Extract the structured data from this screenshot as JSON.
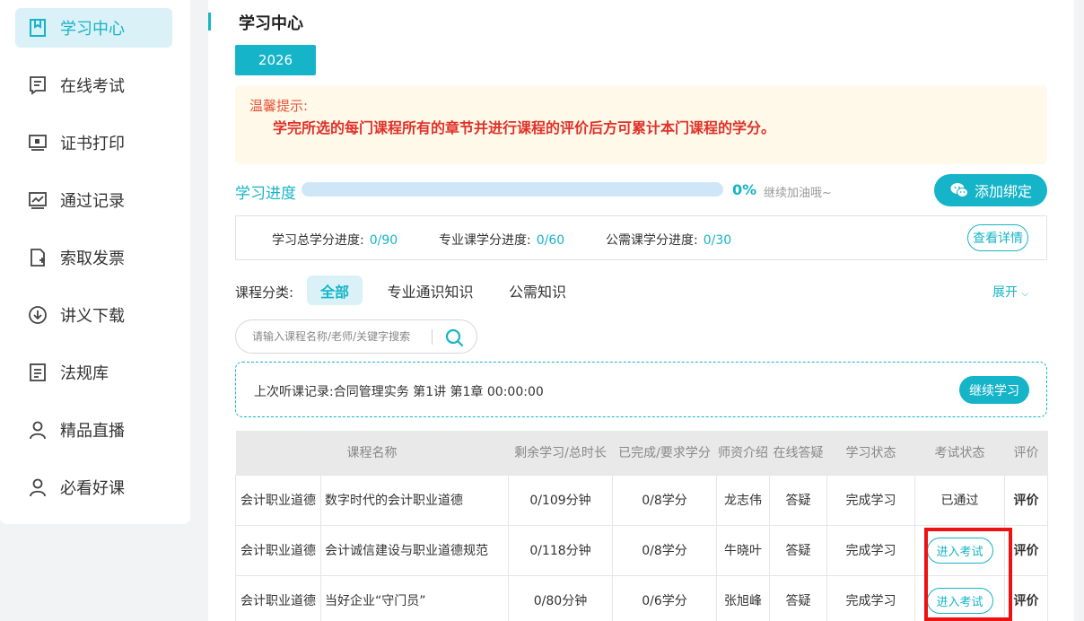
{
  "sidebar": {
    "items": [
      {
        "label": "学习中心",
        "icon": "bookmark-icon",
        "active": true
      },
      {
        "label": "在线考试",
        "icon": "exam-icon",
        "active": false
      },
      {
        "label": "证书打印",
        "icon": "certificate-icon",
        "active": false
      },
      {
        "label": "通过记录",
        "icon": "chart-icon",
        "active": false
      },
      {
        "label": "索取发票",
        "icon": "invoice-icon",
        "active": false
      },
      {
        "label": "讲义下载",
        "icon": "download-icon",
        "active": false
      },
      {
        "label": "法规库",
        "icon": "document-icon",
        "active": false
      },
      {
        "label": "精品直播",
        "icon": "user-icon",
        "active": false
      },
      {
        "label": "必看好课",
        "icon": "user-icon",
        "active": false
      }
    ]
  },
  "header": {
    "title": "学习中心",
    "year_tab": "2026"
  },
  "notice": {
    "heading": "温馨提示:",
    "body": "学完所选的每门课程所有的章节并进行课程的评价后方可累计本门课程的学分。"
  },
  "progress": {
    "label": "学习进度",
    "percent_text": "0%",
    "fraction": 0,
    "hint": "继续加油哦~",
    "bind_button": "添加绑定"
  },
  "credits": {
    "total_label": "学习总学分进度:",
    "total_value": "0/90",
    "major_label": "专业课学分进度:",
    "major_value": "0/60",
    "public_label": "公需课学分进度:",
    "public_value": "0/30",
    "detail_button": "查看详情"
  },
  "categories": {
    "label": "课程分类:",
    "items": [
      "全部",
      "专业通识知识",
      "公需知识"
    ],
    "active_index": 0,
    "expand": "展开"
  },
  "search": {
    "placeholder": "请输入课程名称/老师/关键字搜索"
  },
  "last_record": {
    "text": "上次听课记录:合同管理实务 第1讲 第1章 00:00:00",
    "continue_button": "继续学习"
  },
  "table": {
    "headers": [
      "课程名称",
      "剩余学习/总时长",
      "已完成/要求学分",
      "师资介绍",
      "在线答疑",
      "学习状态",
      "考试状态",
      "评价"
    ],
    "rows": [
      {
        "category": "会计职业道德",
        "name": "数字时代的会计职业道德",
        "duration": "0/109分钟",
        "credits": "0/8学分",
        "teacher": "龙志伟",
        "qa": "答疑",
        "status": "完成学习",
        "exam": "已通过",
        "exam_is_button": false,
        "eval": "评价"
      },
      {
        "category": "会计职业道德",
        "name": "会计诚信建设与职业道德规范",
        "duration": "0/118分钟",
        "credits": "0/8学分",
        "teacher": "牛晓叶",
        "qa": "答疑",
        "status": "完成学习",
        "exam": "进入考试",
        "exam_is_button": true,
        "eval": "评价"
      },
      {
        "category": "会计职业道德",
        "name": "当好企业“守门员”",
        "duration": "0/80分钟",
        "credits": "0/6学分",
        "teacher": "张旭峰",
        "qa": "答疑",
        "status": "完成学习",
        "exam": "进入考试",
        "exam_is_button": true,
        "eval": "评价"
      }
    ]
  },
  "colors": {
    "accent": "#16b4c8",
    "highlight": "#ee1111",
    "notice_text": "#e0312a"
  }
}
